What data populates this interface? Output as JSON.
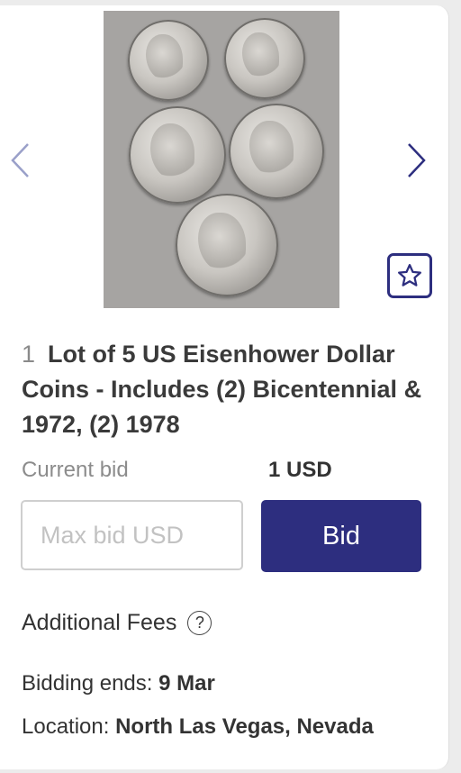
{
  "item": {
    "lot_number": "1",
    "title": "Lot of 5 US Eisenhower Dollar Coins - Includes (2) Bicentennial & 1972, (2) 1978",
    "photo_icon": "coins-photo"
  },
  "gallery": {
    "prev_icon": "chevron-left-icon",
    "next_icon": "chevron-right-icon",
    "watch_icon": "star-icon"
  },
  "bid": {
    "current_label": "Current bid",
    "current_value": "1 USD",
    "max_bid_placeholder": "Max bid USD",
    "bid_button": "Bid"
  },
  "details": {
    "fees_label": "Additional Fees",
    "fees_help_icon": "question-circle-icon",
    "ends_label": "Bidding ends:",
    "ends_value": "9 Mar",
    "location_label": "Location:",
    "location_value": "North Las Vegas, Nevada"
  },
  "colors": {
    "accent": "#2d2e7f",
    "arrow": "#9aa0c9"
  }
}
